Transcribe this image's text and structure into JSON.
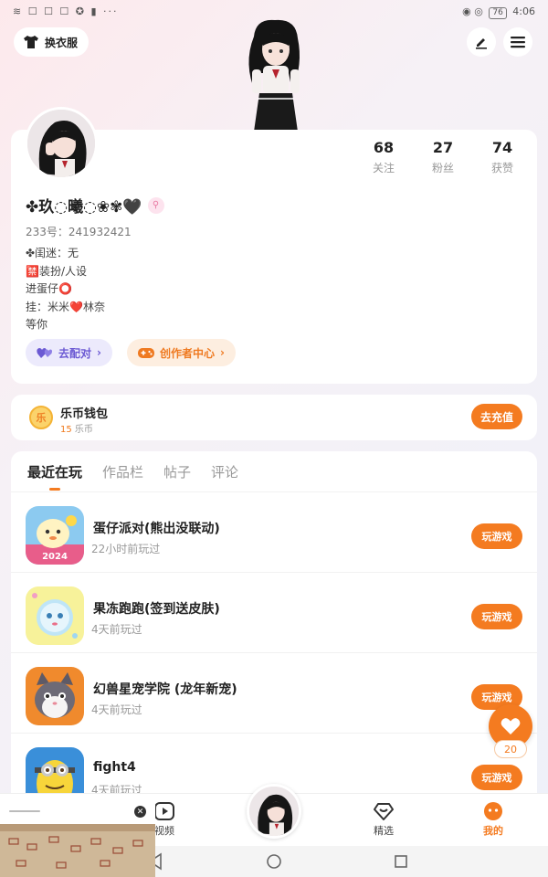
{
  "status_bar": {
    "left_icons": "≋ ☐ ☐ ☐ ✪ ▮ ···",
    "battery": "76",
    "time": "4:06"
  },
  "header": {
    "outfit_label": "换衣服"
  },
  "profile": {
    "nickname": "✤玖◌曦◌❀✾🖤",
    "uid": "233号：241932421",
    "stats": [
      {
        "value": "68",
        "label": "关注"
      },
      {
        "value": "27",
        "label": "粉丝"
      },
      {
        "value": "74",
        "label": "获赞"
      }
    ],
    "bio": [
      "✤闺迷：无",
      "🈲装扮/人设",
      "进蛋仔⭕",
      "挂：米米❤️林奈",
      "等你"
    ],
    "match_label": "去配对",
    "creator_label": "创作者中心"
  },
  "wallet": {
    "coin_char": "乐",
    "title": "乐币钱包",
    "balance": "15",
    "balance_unit": "乐币",
    "recharge_label": "去充值"
  },
  "tabs": [
    {
      "label": "最近在玩",
      "active": true
    },
    {
      "label": "作品栏",
      "active": false
    },
    {
      "label": "帖子",
      "active": false
    },
    {
      "label": "评论",
      "active": false
    }
  ],
  "games": [
    {
      "title": "蛋仔派对(熊出没联动)",
      "time": "22小时前玩过",
      "button": "玩游戏"
    },
    {
      "title": "果冻跑跑(签到送皮肤)",
      "time": "4天前玩过",
      "button": "玩游戏"
    },
    {
      "title": "幻兽星宠学院 (龙年新宠)",
      "time": "4天前玩过",
      "button": "玩游戏"
    },
    {
      "title": "fight4",
      "time": "4天前玩过",
      "button": "玩游戏"
    }
  ],
  "game_badges": {
    "first_badge": "2024"
  },
  "float_like": {
    "count": "20"
  },
  "bottom_nav": {
    "video": "视频",
    "featured": "精选",
    "mine": "我的"
  },
  "colors": {
    "accent": "#f47b20",
    "match_purple": "#6b59d3",
    "card_bg": "#ffffff"
  }
}
